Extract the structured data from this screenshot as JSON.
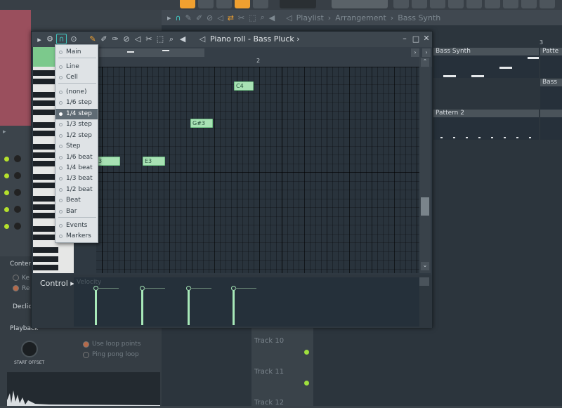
{
  "playlist": {
    "title": "Playlist",
    "crumb_sep": "›",
    "arrangement": "Arrangement",
    "pattern": "Bass Synth",
    "ruler_number": "3",
    "clips": {
      "bass_synth_a": "Bass Synth",
      "bass_synth_b": "Patte",
      "bass_synth_c": "Bass",
      "pattern2": "Pattern 2"
    },
    "tracks": [
      "Track 10",
      "Track 11",
      "Track 12"
    ]
  },
  "piano_roll": {
    "title": "Piano roll - Bass Pluck",
    "arrow_right": "›",
    "bar_number": "2",
    "notes": [
      {
        "label": "C4"
      },
      {
        "label": "G#3"
      },
      {
        "label": "3"
      },
      {
        "label": "E3"
      }
    ],
    "control_label": "Control",
    "control_sub": "Velocity"
  },
  "snap_menu": {
    "items": [
      {
        "label": "Main"
      },
      {
        "label": "Line"
      },
      {
        "label": "Cell"
      },
      {
        "label": "(none)"
      },
      {
        "label": "1/6 step"
      },
      {
        "label": "1/4 step",
        "selected": true
      },
      {
        "label": "1/3 step"
      },
      {
        "label": "1/2 step"
      },
      {
        "label": "Step"
      },
      {
        "label": "1/6 beat"
      },
      {
        "label": "1/4 beat"
      },
      {
        "label": "1/3 beat"
      },
      {
        "label": "1/2 beat"
      },
      {
        "label": "Beat"
      },
      {
        "label": "Bar"
      },
      {
        "label": "Events"
      },
      {
        "label": "Markers"
      }
    ]
  },
  "sampler": {
    "section_center": "Conter",
    "section_decl": "Declic",
    "playback": "Playback",
    "start_offset": "START OFFSET",
    "use_loop_points": "Use loop points",
    "ping_pong": "Ping pong loop",
    "key_label": "Ke",
    "re_label": "Re"
  },
  "colors": {
    "note": "#a8e2b4",
    "accent_orange": "#f0a030",
    "led_green": "#b4e02c",
    "selected": "#5f6b74"
  }
}
